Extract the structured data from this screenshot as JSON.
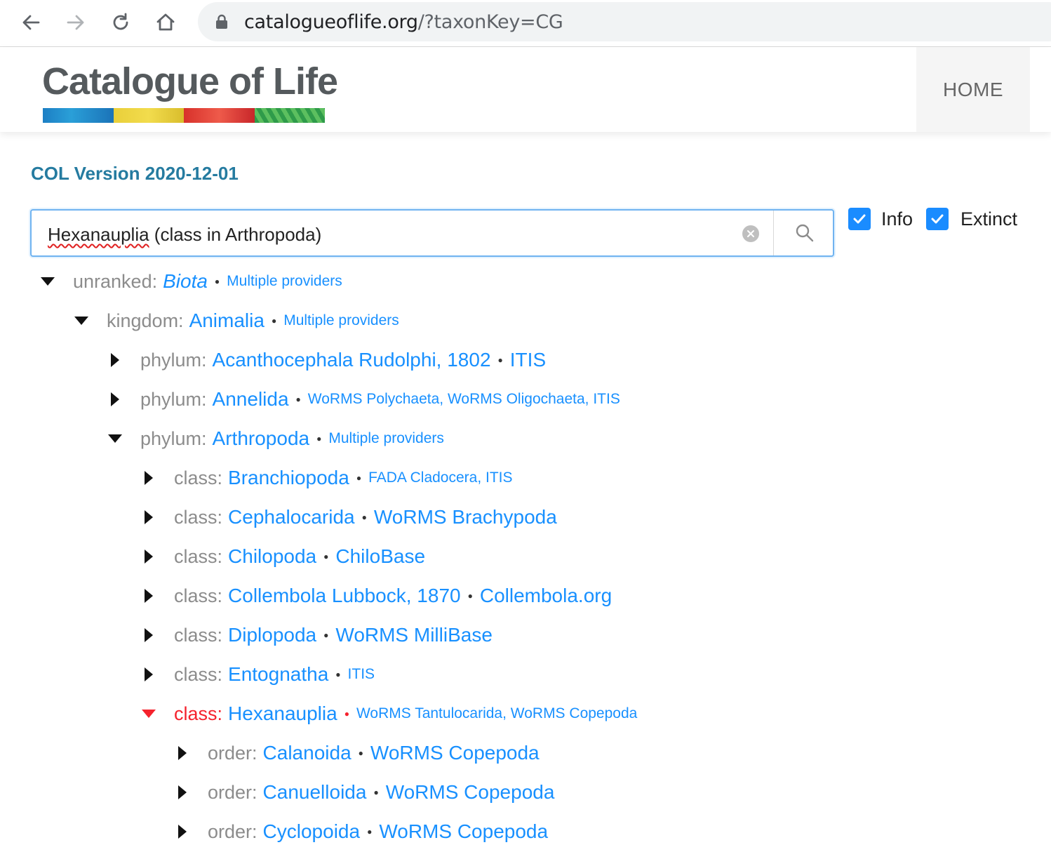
{
  "browser": {
    "url_host": "catalogueoflife.org",
    "url_path": "/?taxonKey=CG"
  },
  "header": {
    "logo_text": "Catalogue of Life",
    "home_label": "HOME"
  },
  "version_label": "COL Version 2020-12-01",
  "search": {
    "value_spellflag": "Hexanauplia",
    "value_rest": " (class in Arthropoda)"
  },
  "options": {
    "info_label": "Info",
    "info_checked": true,
    "extinct_label": "Extinct",
    "extinct_checked": true
  },
  "colors": {
    "link": "#1890ff",
    "rank": "#8c8c8c",
    "active": "#f5222d",
    "version": "#257ba0",
    "checkbox": "#1a8cff"
  },
  "tree": [
    {
      "rank": "unranked:",
      "name": "Biota",
      "provider": "Multiple providers",
      "expanded": true,
      "level": 0,
      "italic": true,
      "provider_size": "small"
    },
    {
      "rank": "kingdom:",
      "name": "Animalia",
      "provider": "Multiple providers",
      "expanded": true,
      "level": 1,
      "provider_size": "small"
    },
    {
      "rank": "phylum:",
      "name": "Acanthocephala Rudolphi, 1802",
      "provider": "ITIS",
      "expanded": false,
      "level": 2,
      "provider_size": "big"
    },
    {
      "rank": "phylum:",
      "name": "Annelida",
      "provider": "WoRMS Polychaeta, WoRMS Oligochaeta, ITIS",
      "expanded": false,
      "level": 2,
      "provider_size": "small"
    },
    {
      "rank": "phylum:",
      "name": "Arthropoda",
      "provider": "Multiple providers",
      "expanded": true,
      "level": 2,
      "provider_size": "small"
    },
    {
      "rank": "class:",
      "name": "Branchiopoda",
      "provider": "FADA Cladocera, ITIS",
      "expanded": false,
      "level": 3,
      "provider_size": "small"
    },
    {
      "rank": "class:",
      "name": "Cephalocarida",
      "provider": "WoRMS Brachypoda",
      "expanded": false,
      "level": 3,
      "provider_size": "big"
    },
    {
      "rank": "class:",
      "name": "Chilopoda",
      "provider": "ChiloBase",
      "expanded": false,
      "level": 3,
      "provider_size": "big"
    },
    {
      "rank": "class:",
      "name": "Collembola Lubbock, 1870",
      "provider": "Collembola.org",
      "expanded": false,
      "level": 3,
      "provider_size": "big"
    },
    {
      "rank": "class:",
      "name": "Diplopoda",
      "provider": "WoRMS MilliBase",
      "expanded": false,
      "level": 3,
      "provider_size": "big"
    },
    {
      "rank": "class:",
      "name": "Entognatha",
      "provider": "ITIS",
      "expanded": false,
      "level": 3,
      "provider_size": "small"
    },
    {
      "rank": "class:",
      "name": "Hexanauplia",
      "provider": "WoRMS Tantulocarida, WoRMS Copepoda",
      "expanded": true,
      "level": 3,
      "active": true,
      "provider_size": "small"
    },
    {
      "rank": "order:",
      "name": "Calanoida",
      "provider": "WoRMS Copepoda",
      "expanded": false,
      "level": 4,
      "provider_size": "big"
    },
    {
      "rank": "order:",
      "name": "Canuelloida",
      "provider": "WoRMS Copepoda",
      "expanded": false,
      "level": 4,
      "provider_size": "big"
    },
    {
      "rank": "order:",
      "name": "Cyclopoida",
      "provider": "WoRMS Copepoda",
      "expanded": false,
      "level": 4,
      "provider_size": "big"
    }
  ]
}
